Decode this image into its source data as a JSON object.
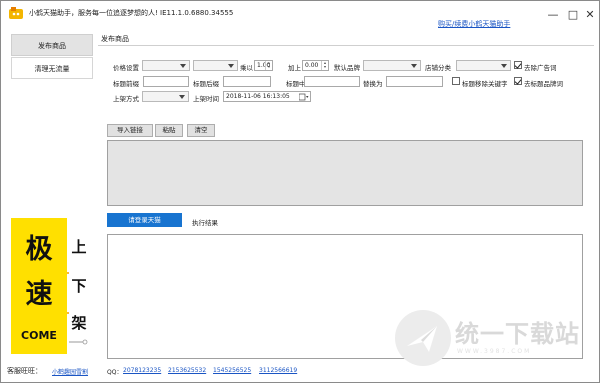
{
  "window": {
    "title": "小鹤天猫助手，服务每一位追逐梦想的人! IE11.1.0.6880.34555",
    "help_link": "购买/续费小鹤天猫助手",
    "controls": [
      "minimize-icon",
      "maximize-icon",
      "close-icon"
    ]
  },
  "sidebar": {
    "items": [
      {
        "label": "发布商品",
        "active": true
      },
      {
        "label": "清理无流量",
        "active": false
      }
    ]
  },
  "banner": {
    "big_chars": [
      "极",
      "速"
    ],
    "small_chars": [
      "上",
      "下",
      "架"
    ],
    "come": "COME"
  },
  "tab": {
    "label": "发布商品"
  },
  "form": {
    "price_label": "价格设置",
    "multiply_label": "乘以",
    "multiply_value": "1.00",
    "add_label": "加上",
    "add_value": "0.00",
    "brand_label": "默认品牌",
    "shop_category_label": "店铺分类",
    "remove_ads_label": "去除广告词",
    "title_prefix_label": "标题前缀",
    "title_suffix_label": "标题后缀",
    "title_middle_label": "标题中",
    "replace_label": "替换为",
    "remove_keywords_label": "标题移除关键字",
    "remove_brand_label": "去标题品牌词",
    "list_method_label": "上架方式",
    "list_time_label": "上架时间",
    "list_time_value": "2018-11-06 16:13:05",
    "remove_ads_checked": true,
    "remove_keywords_checked": false,
    "remove_brand_checked": true
  },
  "actions": {
    "import_label": "导入链接",
    "paste_label": "粘贴",
    "clear_label": "清空"
  },
  "login_button": "请登录天猫",
  "result_tab": "执行结果",
  "footer": {
    "contact_label": "客服旺旺：",
    "contact_name": "小鹤趣园雪割",
    "qq_label": "QQ：",
    "qq_numbers": [
      "2078123235",
      "2153625532",
      "1545256525",
      "3112566619"
    ]
  },
  "watermark": {
    "text": "统一下载站",
    "sub": "WWW.3987.COM"
  },
  "colors": {
    "accent": "#1874d0",
    "banner_yellow": "#ffe000",
    "link": "#1a55c4"
  }
}
